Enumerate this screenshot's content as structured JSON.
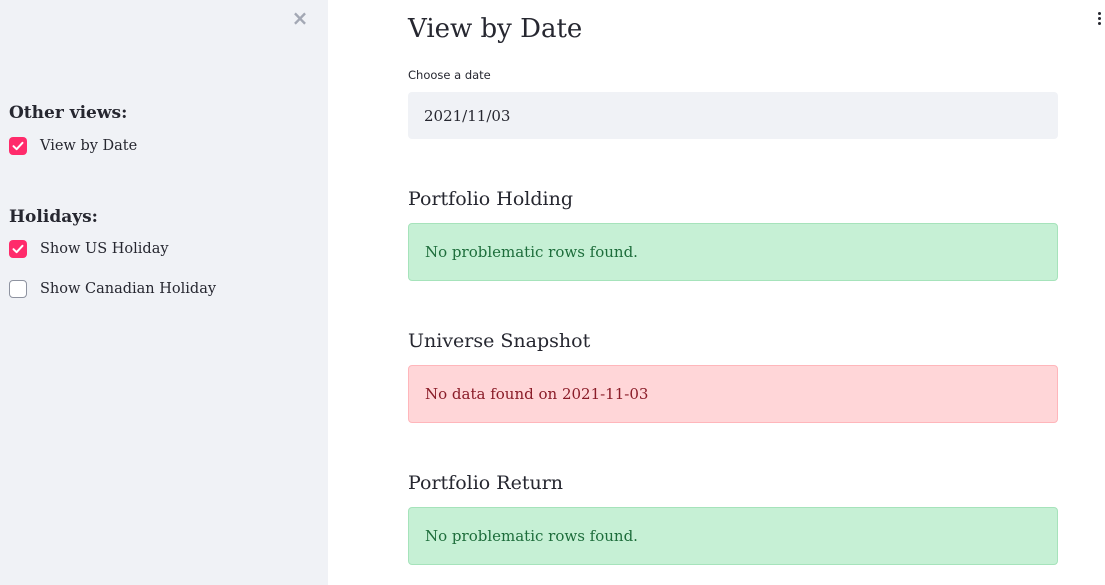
{
  "sidebar": {
    "close_label": "×",
    "other_views_heading": "Other views:",
    "other_views": [
      {
        "label": "View by Date",
        "checked": true
      }
    ],
    "holidays_heading": "Holidays:",
    "holidays": [
      {
        "label": "Show US Holiday",
        "checked": true
      },
      {
        "label": "Show Canadian Holiday",
        "checked": false
      }
    ]
  },
  "main": {
    "title": "View by Date",
    "date_field": {
      "label": "Choose a date",
      "value": "2021/11/03"
    },
    "sections": [
      {
        "title": "Portfolio Holding",
        "status": "success",
        "message": "No problematic rows found."
      },
      {
        "title": "Universe Snapshot",
        "status": "error",
        "message": "No data found on 2021-11-03"
      },
      {
        "title": "Portfolio Return",
        "status": "success",
        "message": "No problematic rows found."
      }
    ]
  },
  "colors": {
    "accent": "#ff2b6b",
    "sidebar_bg": "#f0f2f6",
    "success_bg": "#c6f0d5",
    "error_bg": "#ffd6d8"
  }
}
